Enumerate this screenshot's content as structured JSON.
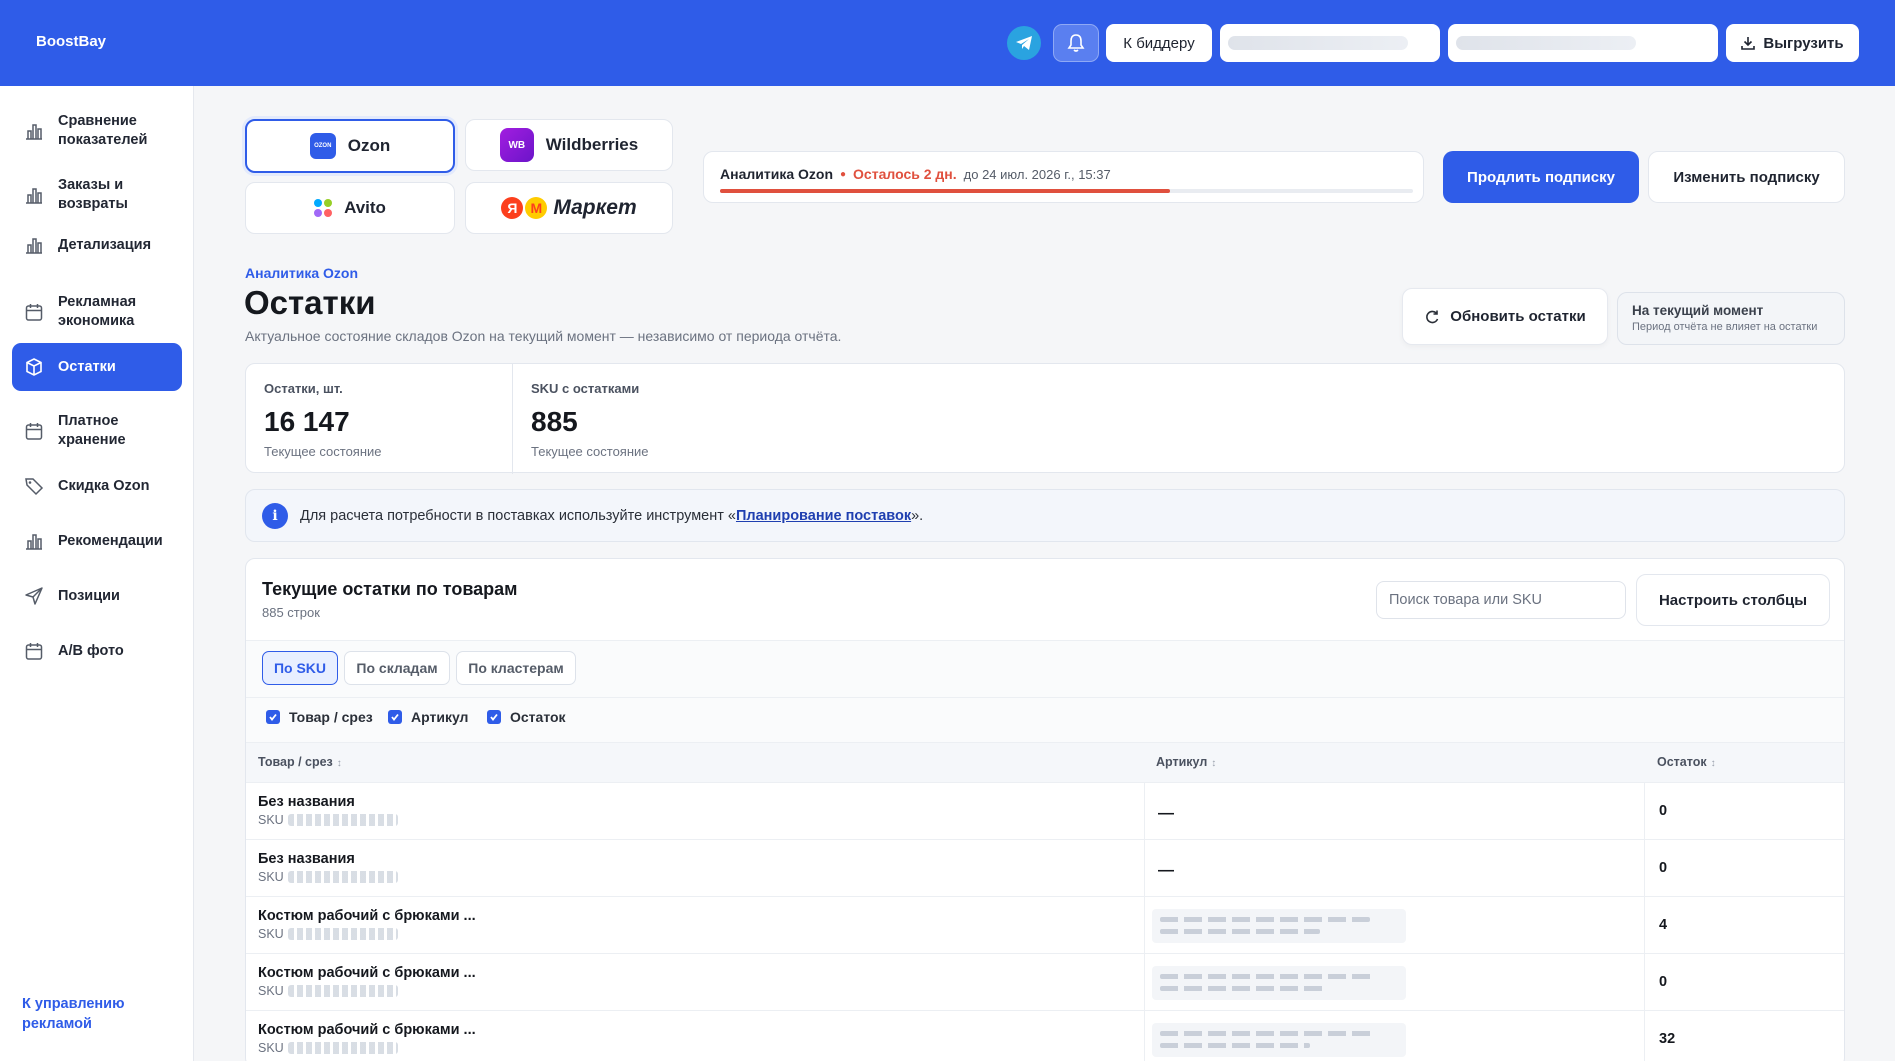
{
  "header": {
    "brand": "BoostBay",
    "bidder_label": "К биддеру",
    "export_label": "Выгрузить"
  },
  "sidebar": {
    "items": [
      {
        "label": "Сравнение показателей",
        "icon": "bar-chart-icon"
      },
      {
        "label": "Заказы и возвраты",
        "icon": "bar-chart-icon"
      },
      {
        "label": "Детализация",
        "icon": "bar-chart-icon"
      },
      {
        "label": "Рекламная экономика",
        "icon": "calendar-icon"
      },
      {
        "label": "Остатки",
        "icon": "box-icon",
        "active": true
      },
      {
        "label": "Платное хранение",
        "icon": "calendar-icon"
      },
      {
        "label": "Скидка Ozon",
        "icon": "tag-icon"
      },
      {
        "label": "Рекомендации",
        "icon": "bar-chart-icon"
      },
      {
        "label": "Позиции",
        "icon": "send-icon"
      },
      {
        "label": "A/B фото",
        "icon": "calendar-icon"
      }
    ],
    "back_link": "К управлению рекламой"
  },
  "marketplaces": {
    "ozon": "Ozon",
    "ozon_logo": "OZON",
    "wb": "Wildberries",
    "wb_logo": "WB",
    "avito": "Avito",
    "market_logo_1": "Я",
    "market_logo_2": "М",
    "market": "Маркет"
  },
  "subscription": {
    "title": "Аналитика Ozon",
    "remaining": "Осталось 2 дн.",
    "until": "до 24 июл. 2026 г., 15:37",
    "progress": 0.65,
    "extend_label": "Продлить подписку",
    "change_label": "Изменить подписку"
  },
  "page": {
    "breadcrumb": "Аналитика Ozon",
    "title": "Остатки",
    "subtitle": "Актуальное состояние складов Ozon на текущий момент — независимо от периода отчёта.",
    "refresh_label": "Обновить остатки",
    "now_title": "На текущий момент",
    "now_note": "Период отчёта не влияет на остатки"
  },
  "kpi": [
    {
      "label": "Остатки, шт.",
      "value": "16 147",
      "note": "Текущее состояние"
    },
    {
      "label": "SKU с остатками",
      "value": "885",
      "note": "Текущее состояние"
    }
  ],
  "info": {
    "icon": "i",
    "before": "Для расчета потребности в поставках используйте инструмент «",
    "link": "Планирование поставок",
    "after": "»."
  },
  "table": {
    "title": "Текущие остатки по товарам",
    "count": "885 строк",
    "search_placeholder": "Поиск товара или SKU",
    "columns_btn": "Настроить столбцы",
    "tabs": [
      "По SKU",
      "По складам",
      "По кластерам"
    ],
    "checks": [
      "Товар / срез",
      "Артикул",
      "Остаток"
    ],
    "headers": [
      "Товар / срез",
      "Артикул",
      "Остаток"
    ],
    "sort_glyph": "↕",
    "sku_label": "SKU",
    "rows": [
      {
        "name": "Без названия",
        "article": "—",
        "qty": "0"
      },
      {
        "name": "Без названия",
        "article": "—",
        "qty": "0"
      },
      {
        "name": "Костюм рабочий с брюками ...",
        "article": "",
        "qty": "4"
      },
      {
        "name": "Костюм рабочий с брюками ...",
        "article": "",
        "qty": "0"
      },
      {
        "name": "Костюм рабочий с брюками ...",
        "article": "",
        "qty": "32"
      }
    ]
  },
  "colors": {
    "primary": "#2f5ce8",
    "warning": "#e0503e"
  }
}
